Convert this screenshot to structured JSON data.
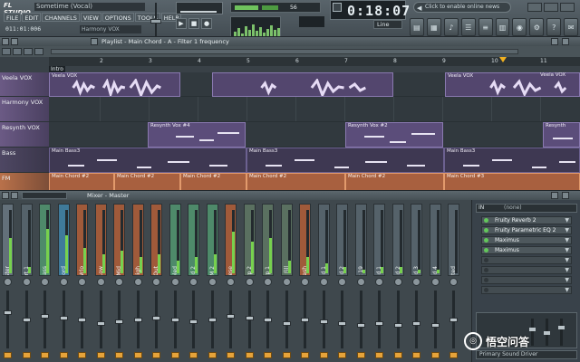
{
  "app": {
    "logo": "FL STUDIO",
    "song_title": "Sometime (Vocal)",
    "menu": [
      "FILE",
      "EDIT",
      "CHANNELS",
      "VIEW",
      "OPTIONS",
      "TOOLS",
      "HELP"
    ],
    "small_time": "011:01:006",
    "hint_text": "Harmony VOX",
    "main_time": "0:18:07",
    "time_mode": "",
    "line_select": "Line",
    "tempo": "56",
    "cpu_digits": "",
    "news_text": "Click to enable online news",
    "transport": [
      "▶",
      "■",
      "●"
    ]
  },
  "playlist": {
    "title": "Playlist - Main Chord - A - Filter 1 frequency",
    "ruler_marks": [
      "2",
      "3",
      "4",
      "5",
      "6",
      "7",
      "8",
      "9",
      "10",
      "11"
    ],
    "intro_marker": "Intro",
    "tracks": [
      {
        "label": "Veela VOX",
        "clips": [
          "Veela VOX",
          "Veela VOX",
          "Veela VOX"
        ]
      },
      {
        "label": "Harmony VOX",
        "clips": []
      },
      {
        "label": "Resynth VOX",
        "clips": [
          "Resynth Vox #4",
          "Resynth Vox #2",
          "Resynth"
        ]
      },
      {
        "label": "Bass",
        "clips": [
          "Main Bass3",
          "Main Bass3",
          "Main Bass3"
        ]
      },
      {
        "label": "FM",
        "clips": [
          "Main Chord #2",
          "Main Chord #2",
          "Main Chord #2",
          "Main Chord #2",
          "Main Chord #2",
          "Main Chord #3"
        ]
      }
    ]
  },
  "mixer": {
    "title": "Mixer - Master",
    "strips": [
      "Master",
      "Insert 1",
      "Main Bass",
      "Main Chord",
      "FM Wrlo",
      "Low",
      "Mid",
      "High",
      "Out",
      "Doubled",
      "Doubled 2",
      "FM 2",
      "Square Reese",
      "Arp 2",
      "Arp 1",
      "Fill",
      "Crash",
      "Build 1",
      "Build 2",
      "Insert 19",
      "Send 1",
      "Send 2",
      "Send 3",
      "Send 4",
      "Selected"
    ],
    "insert_header_label": "IN",
    "insert_header_value": "(none)",
    "inserts": [
      "Fruity Reverb 2",
      "Fruity Parametric EQ 2",
      "Maximus",
      "Maximus",
      "",
      "",
      "",
      ""
    ],
    "output_label": "Primary Sound Driver"
  },
  "watermark": {
    "logo": "悟",
    "text": "悟空问答"
  },
  "colors": {
    "accent_vox": "#8a79b0",
    "accent_fm": "#e29a6c",
    "meter_green": "#77d14e",
    "route_orange": "#e6a33a"
  }
}
